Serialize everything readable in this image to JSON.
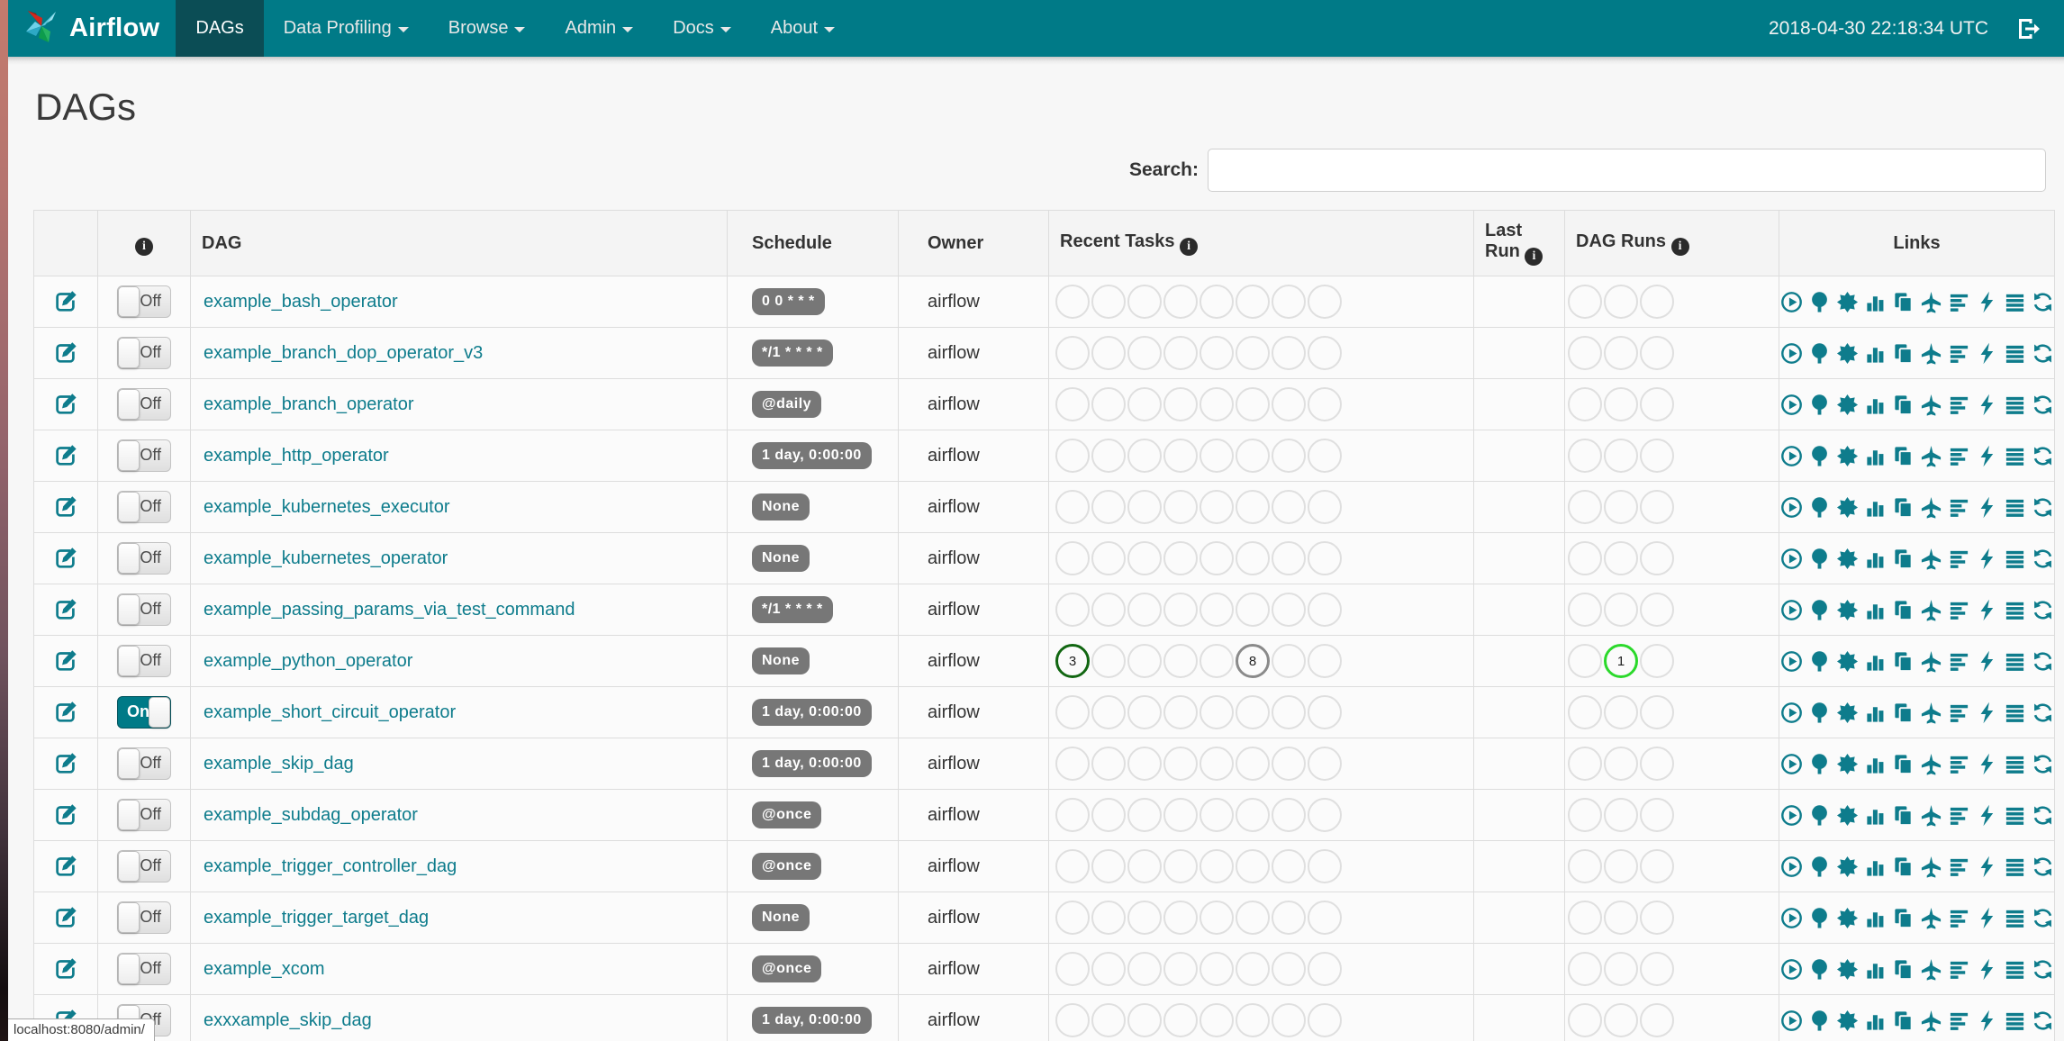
{
  "navbar": {
    "brand": "Airflow",
    "items": [
      {
        "label": "DAGs",
        "active": true,
        "caret": false
      },
      {
        "label": "Data Profiling",
        "active": false,
        "caret": true
      },
      {
        "label": "Browse",
        "active": false,
        "caret": true
      },
      {
        "label": "Admin",
        "active": false,
        "caret": true
      },
      {
        "label": "Docs",
        "active": false,
        "caret": true
      },
      {
        "label": "About",
        "active": false,
        "caret": true
      }
    ],
    "clock": "2018-04-30 22:18:34 UTC"
  },
  "page": {
    "title": "DAGs"
  },
  "search": {
    "label": "Search:",
    "value": ""
  },
  "toggle_labels": {
    "on": "On",
    "off": "Off"
  },
  "icons": {
    "info_glyph": "i"
  },
  "table": {
    "headers": {
      "edit": "",
      "dag": "DAG",
      "schedule": "Schedule",
      "owner": "Owner",
      "recent_tasks": "Recent Tasks",
      "last_run": "Last Run",
      "dag_runs": "DAG Runs",
      "links": "Links"
    },
    "recent_task_slots": 8,
    "dag_run_slots": 3,
    "links": [
      {
        "name": "trigger-dag"
      },
      {
        "name": "tree-view"
      },
      {
        "name": "graph-view"
      },
      {
        "name": "task-duration"
      },
      {
        "name": "task-tries"
      },
      {
        "name": "landing-times"
      },
      {
        "name": "gantt"
      },
      {
        "name": "code-view"
      },
      {
        "name": "logs"
      },
      {
        "name": "refresh"
      }
    ],
    "rows": [
      {
        "name": "example_bash_operator",
        "schedule": "0 0 * * *",
        "owner": "airflow",
        "enabled": false,
        "recent_tasks": [],
        "dag_runs": [],
        "last_run": ""
      },
      {
        "name": "example_branch_dop_operator_v3",
        "schedule": "*/1 * * * *",
        "owner": "airflow",
        "enabled": false,
        "recent_tasks": [],
        "dag_runs": [],
        "last_run": ""
      },
      {
        "name": "example_branch_operator",
        "schedule": "@daily",
        "owner": "airflow",
        "enabled": false,
        "recent_tasks": [],
        "dag_runs": [],
        "last_run": ""
      },
      {
        "name": "example_http_operator",
        "schedule": "1 day, 0:00:00",
        "owner": "airflow",
        "enabled": false,
        "recent_tasks": [],
        "dag_runs": [],
        "last_run": ""
      },
      {
        "name": "example_kubernetes_executor",
        "schedule": "None",
        "owner": "airflow",
        "enabled": false,
        "recent_tasks": [],
        "dag_runs": [],
        "last_run": ""
      },
      {
        "name": "example_kubernetes_operator",
        "schedule": "None",
        "owner": "airflow",
        "enabled": false,
        "recent_tasks": [],
        "dag_runs": [],
        "last_run": ""
      },
      {
        "name": "example_passing_params_via_test_command",
        "schedule": "*/1 * * * *",
        "owner": "airflow",
        "enabled": false,
        "recent_tasks": [],
        "dag_runs": [],
        "last_run": ""
      },
      {
        "name": "example_python_operator",
        "schedule": "None",
        "owner": "airflow",
        "enabled": false,
        "recent_tasks": [
          {
            "slot": 0,
            "count": 3,
            "state": "success"
          },
          {
            "slot": 5,
            "count": 8,
            "state": "queued"
          }
        ],
        "dag_runs": [
          {
            "slot": 1,
            "count": 1,
            "state": "running"
          }
        ],
        "last_run": ""
      },
      {
        "name": "example_short_circuit_operator",
        "schedule": "1 day, 0:00:00",
        "owner": "airflow",
        "enabled": true,
        "recent_tasks": [],
        "dag_runs": [],
        "last_run": ""
      },
      {
        "name": "example_skip_dag",
        "schedule": "1 day, 0:00:00",
        "owner": "airflow",
        "enabled": false,
        "recent_tasks": [],
        "dag_runs": [],
        "last_run": ""
      },
      {
        "name": "example_subdag_operator",
        "schedule": "@once",
        "owner": "airflow",
        "enabled": false,
        "recent_tasks": [],
        "dag_runs": [],
        "last_run": ""
      },
      {
        "name": "example_trigger_controller_dag",
        "schedule": "@once",
        "owner": "airflow",
        "enabled": false,
        "recent_tasks": [],
        "dag_runs": [],
        "last_run": ""
      },
      {
        "name": "example_trigger_target_dag",
        "schedule": "None",
        "owner": "airflow",
        "enabled": false,
        "recent_tasks": [],
        "dag_runs": [],
        "last_run": ""
      },
      {
        "name": "example_xcom",
        "schedule": "@once",
        "owner": "airflow",
        "enabled": false,
        "recent_tasks": [],
        "dag_runs": [],
        "last_run": ""
      },
      {
        "name": "exxxample_skip_dag",
        "schedule": "1 day, 0:00:00",
        "owner": "airflow",
        "enabled": false,
        "recent_tasks": [],
        "dag_runs": [],
        "last_run": ""
      }
    ]
  },
  "status_bar": {
    "url": "localhost:8080/admin/"
  },
  "colors": {
    "navbar": "#007A87",
    "navbar_active": "#0B4D55",
    "link": "#0E7C8C",
    "icon": "#0E7C8C",
    "badge": "#777777",
    "circle_border": "#DFDFDF",
    "success": "#116611",
    "queued": "#8A8A8A",
    "running": "#2BD92B"
  }
}
